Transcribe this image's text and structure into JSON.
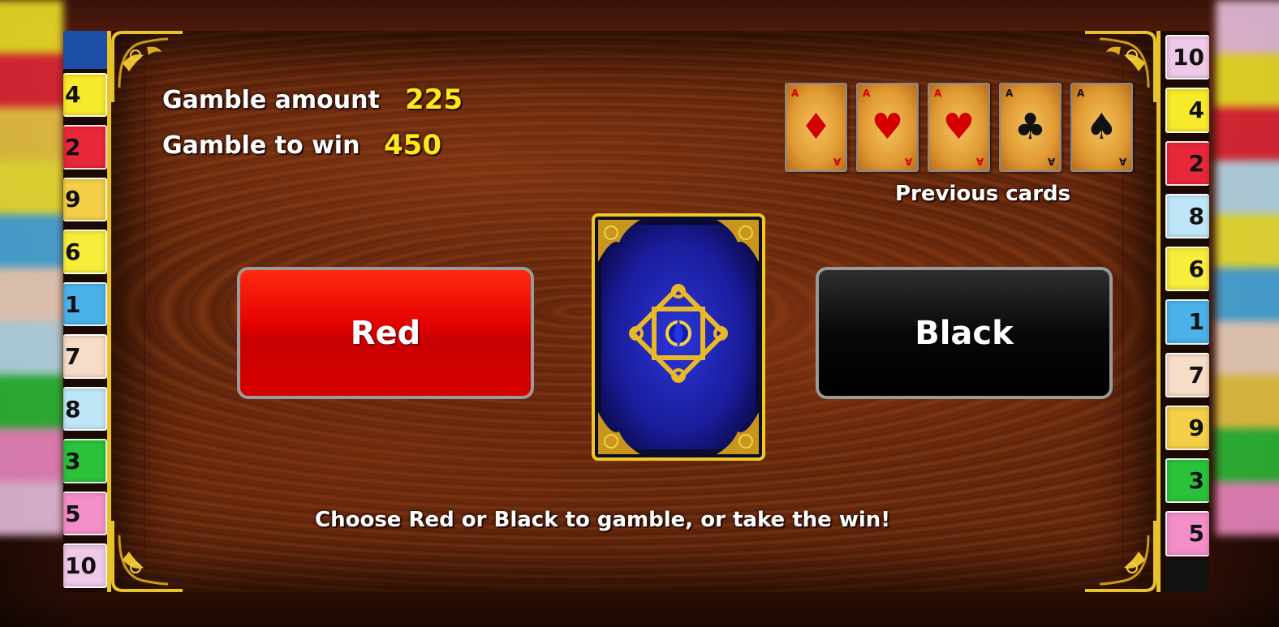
{
  "gamble": {
    "amount_label": "Gamble amount",
    "amount_value": "225",
    "to_win_label": "Gamble to win",
    "to_win_value": "450"
  },
  "previous_cards": {
    "label": "Previous cards",
    "cards": [
      {
        "rank": "A",
        "suit": "diamonds",
        "symbol": "♦",
        "color": "#d40000"
      },
      {
        "rank": "A",
        "suit": "hearts",
        "symbol": "♥",
        "color": "#d40000"
      },
      {
        "rank": "A",
        "suit": "hearts",
        "symbol": "♥",
        "color": "#d40000"
      },
      {
        "rank": "A",
        "suit": "clubs",
        "symbol": "♣",
        "color": "#111111"
      },
      {
        "rank": "A",
        "suit": "spades",
        "symbol": "♠",
        "color": "#111111"
      }
    ]
  },
  "buttons": {
    "red_label": "Red",
    "black_label": "Black"
  },
  "face_down_card": {
    "icon": "card-back-icon"
  },
  "instruction": "Choose Red or Black to gamble, or take the win!",
  "side_numbers": {
    "left": [
      {
        "n": "4",
        "color": "#f7ea2a"
      },
      {
        "n": "2",
        "color": "#e8283a"
      },
      {
        "n": "9",
        "color": "#f3d048"
      },
      {
        "n": "6",
        "color": "#f6ee3a"
      },
      {
        "n": "1",
        "color": "#4ab2e8"
      },
      {
        "n": "7",
        "color": "#f7dcc8"
      },
      {
        "n": "8",
        "color": "#bfe6f7"
      },
      {
        "n": "3",
        "color": "#2bc23b"
      },
      {
        "n": "5",
        "color": "#f48ec8"
      },
      {
        "n": "10",
        "color": "#f0c8e8"
      }
    ],
    "right": [
      {
        "n": "10",
        "color": "#f0c8e8"
      },
      {
        "n": "4",
        "color": "#f7ea2a"
      },
      {
        "n": "2",
        "color": "#e8283a"
      },
      {
        "n": "8",
        "color": "#bfe6f7"
      },
      {
        "n": "6",
        "color": "#f6ee3a"
      },
      {
        "n": "1",
        "color": "#4ab2e8"
      },
      {
        "n": "7",
        "color": "#f7dcc8"
      },
      {
        "n": "9",
        "color": "#f3d048"
      },
      {
        "n": "3",
        "color": "#2bc23b"
      },
      {
        "n": "5",
        "color": "#f48ec8"
      }
    ]
  },
  "colors": {
    "gold": "#e8c22a",
    "value_yellow": "#ffe81a",
    "red_button": "#e20000",
    "black_button": "#080808"
  }
}
